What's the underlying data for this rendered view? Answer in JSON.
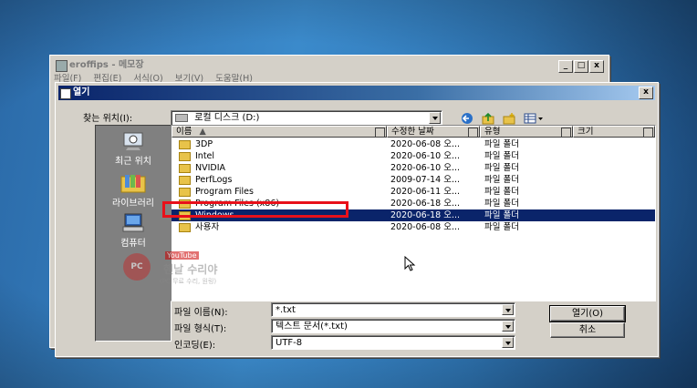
{
  "colors": {
    "title_active": "#0a246a",
    "selection": "#0a246a",
    "highlight_box": "#e8101a",
    "dialog_face": "#d4d0c8",
    "desktop": "#2f76b5"
  },
  "notepad": {
    "title": "eroffips - 메모장",
    "menu": [
      "파일(F)",
      "편집(E)",
      "서식(O)",
      "보기(V)",
      "도움말(H)"
    ],
    "controls": [
      "_",
      "□",
      "x"
    ]
  },
  "dialog": {
    "title": "열기",
    "close": "x",
    "look_in_label": "찾는 위치(I):",
    "look_in_value": "로컬 디스크 (D:)",
    "toolbar_icons": [
      "back-icon",
      "up-folder-icon",
      "new-folder-icon",
      "view-menu-icon"
    ],
    "places": [
      {
        "label": "최근 위치",
        "icon": "recent-places-icon"
      },
      {
        "label": "라이브러리",
        "icon": "libraries-icon"
      },
      {
        "label": "컴퓨터",
        "icon": "computer-icon"
      }
    ],
    "columns": [
      "이름",
      "수정한 날짜",
      "유형",
      "크기"
    ],
    "files": [
      {
        "name": "3DP",
        "date": "2020-06-08 오...",
        "type": "파일 폴더"
      },
      {
        "name": "Intel",
        "date": "2020-06-10 오...",
        "type": "파일 폴더"
      },
      {
        "name": "NVIDIA",
        "date": "2020-06-10 오...",
        "type": "파일 폴더"
      },
      {
        "name": "PerfLogs",
        "date": "2009-07-14 오...",
        "type": "파일 폴더"
      },
      {
        "name": "Program Files",
        "date": "2020-06-11 오...",
        "type": "파일 폴더"
      },
      {
        "name": "Program Files (x86)",
        "date": "2020-06-18 오...",
        "type": "파일 폴더"
      },
      {
        "name": "Windows",
        "date": "2020-06-18 오...",
        "type": "파일 폴더",
        "selected": true
      },
      {
        "name": "사용자",
        "date": "2020-06-08 오...",
        "type": "파일 폴더"
      }
    ],
    "filename_label": "파일 이름(N):",
    "filename_value": "*.txt",
    "filetype_label": "파일 형식(T):",
    "filetype_value": "텍스트 문서(*.txt)",
    "encoding_label": "인코딩(E):",
    "encoding_value": "UTF-8",
    "open_button": "열기(O)",
    "cancel_button": "취소"
  },
  "watermark": {
    "badge": "PC",
    "channel": "YouTube",
    "name": "핸날 수리야",
    "subtitle": "(PC 무료 수리, 원링)"
  }
}
